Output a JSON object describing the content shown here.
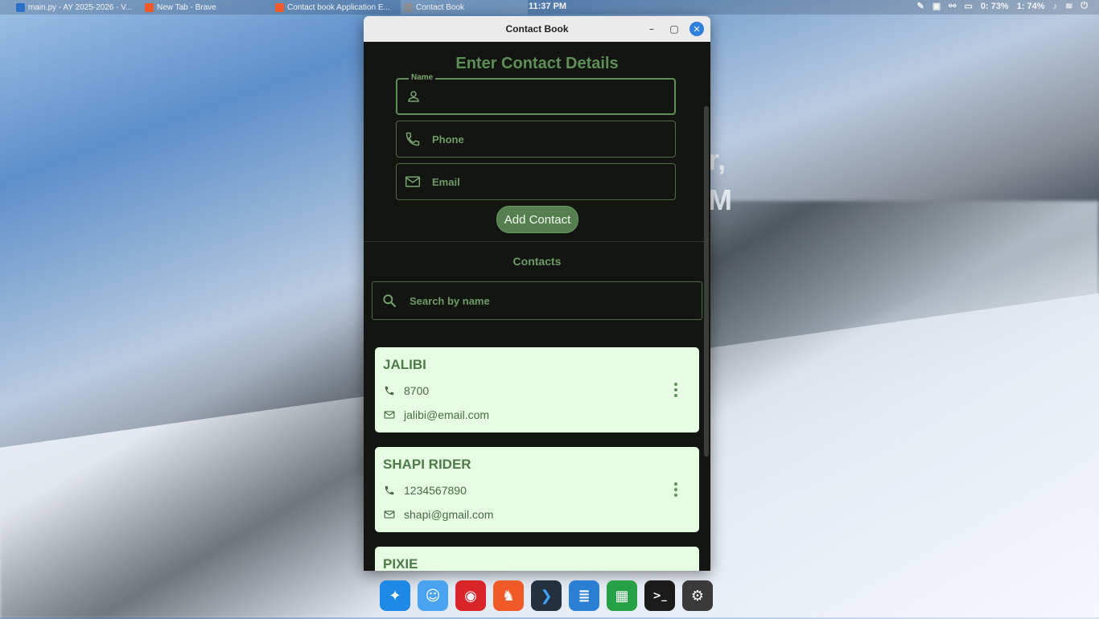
{
  "taskbar": {
    "tasks": [
      {
        "label": "main.py - AY 2025-2026 - V...",
        "icon": "vscode-icon",
        "color": "#2a70c8"
      },
      {
        "label": "New Tab - Brave",
        "icon": "brave-icon",
        "color": "#f05a28"
      },
      {
        "label": "Contact book Application E...",
        "icon": "brave-icon",
        "color": "#f05a28"
      },
      {
        "label": "Contact Book",
        "icon": "app-window-icon",
        "color": "#8a8f98"
      }
    ],
    "clock": "11:37 PM",
    "battery": "0: 73%",
    "battery2": "1: 74%"
  },
  "background": {
    "partial_text_1": "r,",
    "partial_text_2": "M"
  },
  "window": {
    "title": "Contact Book"
  },
  "form": {
    "heading": "Enter Contact Details",
    "name_label": "Name",
    "phone_placeholder": "Phone",
    "email_placeholder": "Email",
    "add_button": "Add Contact"
  },
  "contacts": {
    "heading": "Contacts",
    "search_placeholder": "Search by name",
    "items": [
      {
        "name": "JALIBI",
        "phone": "8700",
        "email": "jalibi@email.com"
      },
      {
        "name": "SHAPI RIDER",
        "phone": "1234567890",
        "email": "shapi@gmail.com"
      },
      {
        "name": "PIXIE",
        "phone": "",
        "email": ""
      }
    ]
  },
  "dock": {
    "apps": [
      {
        "icon": "launcher-icon",
        "color": "#1e88e5",
        "glyph": "✦"
      },
      {
        "icon": "finder-icon",
        "color": "#4aa3f0",
        "glyph": "☺"
      },
      {
        "icon": "screenshot-icon",
        "color": "#d9252a",
        "glyph": "◉"
      },
      {
        "icon": "brave-icon",
        "color": "#f05a28",
        "glyph": "♞"
      },
      {
        "icon": "vscode-icon",
        "color": "#23303f",
        "glyph": "❯"
      },
      {
        "icon": "document-viewer-icon",
        "color": "#2a7ed3",
        "glyph": "≣"
      },
      {
        "icon": "spreadsheet-icon",
        "color": "#27a146",
        "glyph": "▦"
      },
      {
        "icon": "terminal-icon",
        "color": "#1b1b1b",
        "glyph": ">_"
      },
      {
        "icon": "settings-icon",
        "color": "#3a3a3a",
        "glyph": "⚙"
      }
    ]
  }
}
